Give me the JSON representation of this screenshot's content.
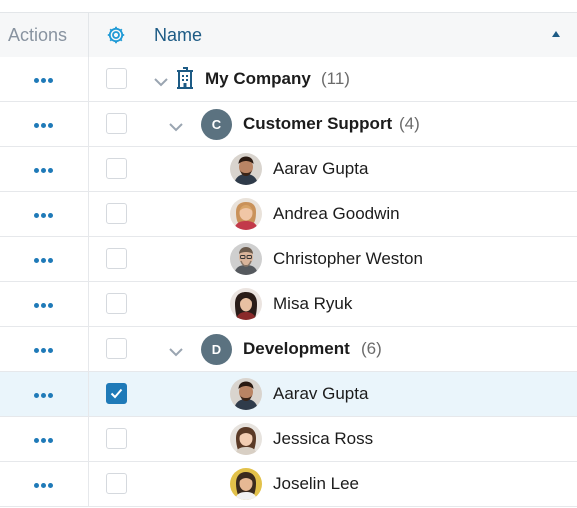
{
  "header": {
    "actions_label": "Actions",
    "name_label": "Name",
    "settings_icon": "gear-icon",
    "sort_icon": "sort-ascending-icon"
  },
  "colors": {
    "accent": "#1f7ab8",
    "header_bg": "#f6f7f8",
    "selected_row_bg": "#eaf5fb",
    "badge_bg": "#5b7280"
  },
  "rows": [
    {
      "type": "group",
      "label": "My Company",
      "count": "(11)",
      "icon": "building-icon",
      "checked": false
    },
    {
      "type": "group",
      "label": "Customer Support",
      "count": "(4)",
      "badge": "C",
      "checked": false
    },
    {
      "type": "person",
      "label": "Aarav Gupta",
      "checked": false
    },
    {
      "type": "person",
      "label": "Andrea Goodwin",
      "checked": false
    },
    {
      "type": "person",
      "label": "Christopher Weston",
      "checked": false
    },
    {
      "type": "person",
      "label": "Misa Ryuk",
      "checked": false
    },
    {
      "type": "group",
      "label": "Development",
      "count": "(6)",
      "badge": "D",
      "checked": false
    },
    {
      "type": "person",
      "label": "Aarav Gupta",
      "checked": true
    },
    {
      "type": "person",
      "label": "Jessica Ross",
      "checked": false
    },
    {
      "type": "person",
      "label": "Joselin Lee",
      "checked": false
    }
  ]
}
